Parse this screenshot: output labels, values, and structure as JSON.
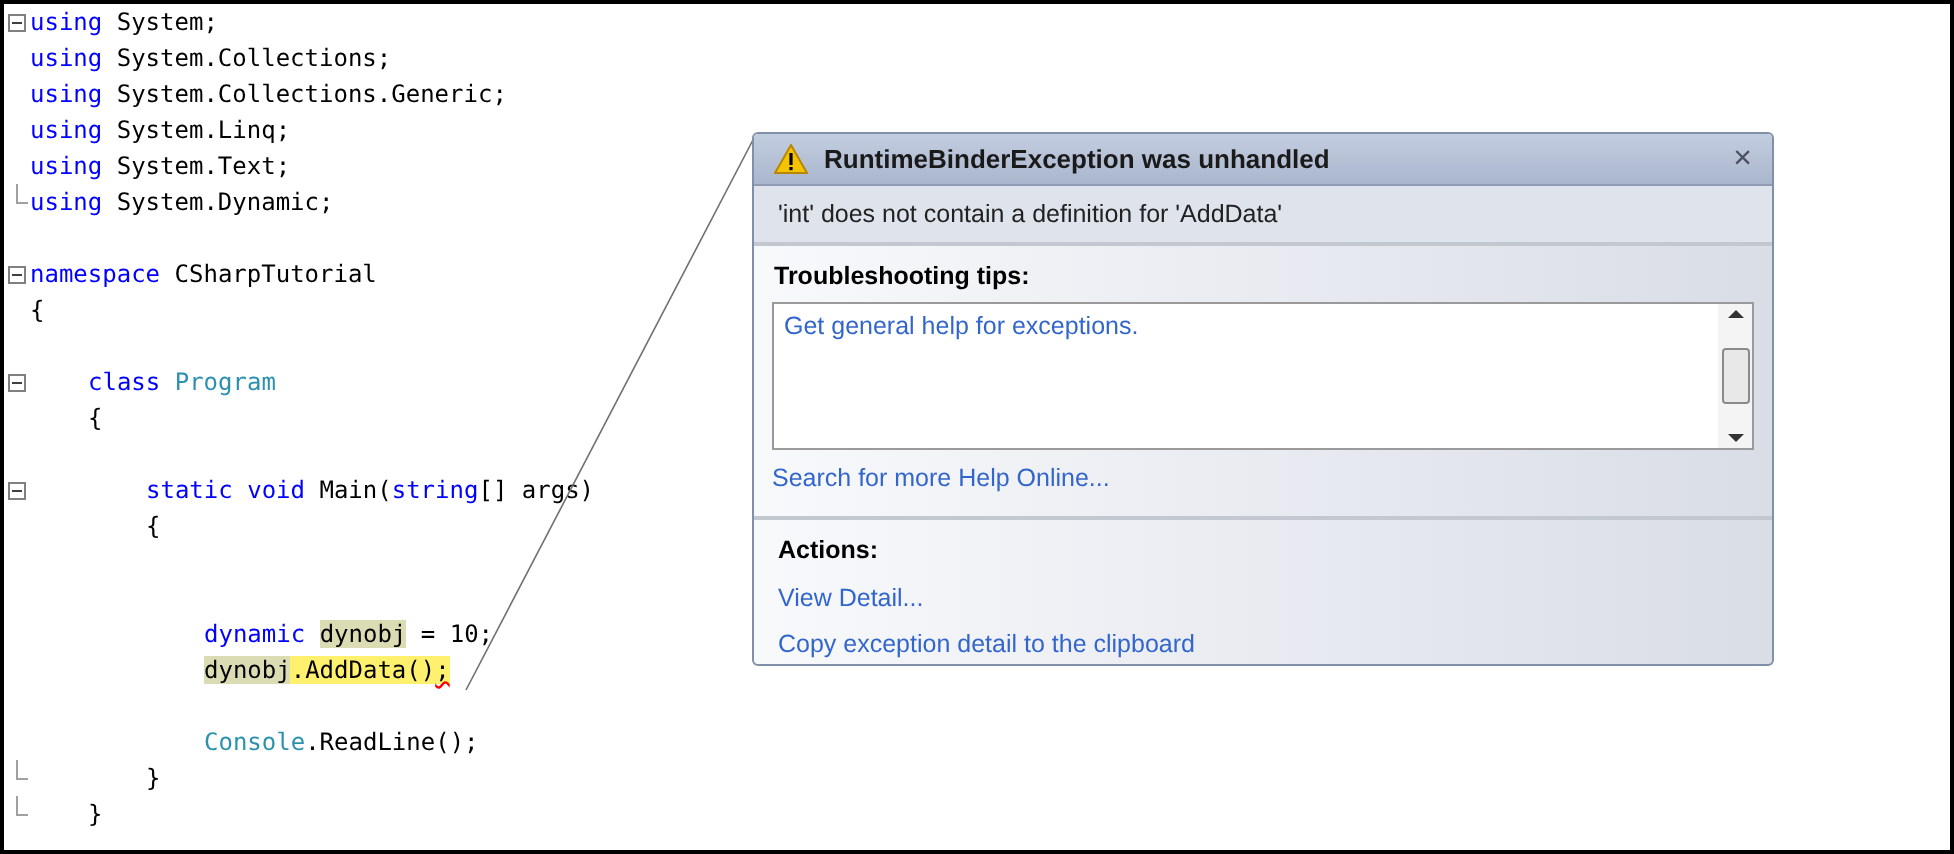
{
  "editor": {
    "lines": [
      {
        "kind": "code",
        "fold_start": true,
        "tokens": [
          {
            "kind": "keyword",
            "text": "using"
          },
          {
            "kind": "plain",
            "text": " System;"
          }
        ]
      },
      {
        "kind": "code",
        "tokens": [
          {
            "kind": "keyword",
            "text": "using"
          },
          {
            "kind": "plain",
            "text": " System.Collections;"
          }
        ]
      },
      {
        "kind": "code",
        "tokens": [
          {
            "kind": "keyword",
            "text": "using"
          },
          {
            "kind": "plain",
            "text": " System.Collections.Generic;"
          }
        ]
      },
      {
        "kind": "code",
        "tokens": [
          {
            "kind": "keyword",
            "text": "using"
          },
          {
            "kind": "plain",
            "text": " System.Linq;"
          }
        ]
      },
      {
        "kind": "code",
        "tokens": [
          {
            "kind": "keyword",
            "text": "using"
          },
          {
            "kind": "plain",
            "text": " System.Text;"
          }
        ]
      },
      {
        "kind": "code",
        "fold_end": true,
        "tokens": [
          {
            "kind": "keyword",
            "text": "using"
          },
          {
            "kind": "plain",
            "text": " System.Dynamic;"
          }
        ]
      },
      {
        "kind": "blank"
      },
      {
        "kind": "code",
        "fold_start": true,
        "tokens": [
          {
            "kind": "keyword",
            "text": "namespace"
          },
          {
            "kind": "plain",
            "text": " CSharpTutorial"
          }
        ]
      },
      {
        "kind": "code",
        "tokens": [
          {
            "kind": "plain",
            "text": "{"
          }
        ],
        "children": [
          {
            "kind": "blank"
          },
          {
            "kind": "code",
            "fold_start": true,
            "tokens": [
              {
                "kind": "keyword",
                "text": "class"
              },
              {
                "kind": "type",
                "text": " Program"
              }
            ]
          },
          {
            "kind": "code",
            "tokens": [
              {
                "kind": "plain",
                "text": "{"
              }
            ],
            "children": [
              {
                "kind": "blank"
              },
              {
                "kind": "code",
                "fold_start": true,
                "tokens": [
                  {
                    "kind": "keyword",
                    "text": "static"
                  },
                  {
                    "kind": "keyword",
                    "text": " void"
                  },
                  {
                    "kind": "plain",
                    "text": " Main("
                  },
                  {
                    "kind": "keyword",
                    "text": "string"
                  },
                  {
                    "kind": "plain",
                    "text": "[] args)"
                  }
                ]
              },
              {
                "kind": "code",
                "tokens": [
                  {
                    "kind": "plain",
                    "text": "{"
                  }
                ],
                "children": [
                  {
                    "kind": "blank"
                  },
                  {
                    "kind": "blank"
                  },
                  {
                    "kind": "code",
                    "tokens": [
                      {
                        "kind": "keyword",
                        "text": "dynamic"
                      },
                      {
                        "kind": "reference",
                        "text": " dynobj"
                      },
                      {
                        "kind": "plain",
                        "text": " = 10;"
                      }
                    ]
                  },
                  {
                    "kind": "code",
                    "tokens": [
                      {
                        "kind": "reference",
                        "text": "dynobj"
                      },
                      {
                        "kind": "current",
                        "text": ".AddData()"
                      },
                      {
                        "kind": "error",
                        "text": ";"
                      }
                    ]
                  },
                  {
                    "kind": "blank"
                  },
                  {
                    "kind": "code",
                    "tokens": [
                      {
                        "kind": "type",
                        "text": "Console"
                      },
                      {
                        "kind": "plain",
                        "text": ".ReadLine();"
                      }
                    ]
                  }
                ]
              },
              {
                "kind": "code",
                "fold_end": true,
                "tokens": [
                  {
                    "kind": "plain",
                    "text": "}"
                  }
                ]
              }
            ]
          },
          {
            "kind": "code",
            "fold_end": true,
            "tokens": [
              {
                "kind": "plain",
                "text": "}"
              }
            ]
          }
        ]
      }
    ]
  },
  "exception_helper": {
    "title": "RuntimeBinderException was unhandled",
    "close": "×",
    "message": "'int' does not contain a definition for 'AddData'",
    "tips_heading": "Troubleshooting tips:",
    "tips": [
      "Get general help for exceptions."
    ],
    "help_link": "Search for more Help Online...",
    "actions_heading": "Actions:",
    "actions": [
      "View Detail...",
      "Copy exception detail to the clipboard"
    ]
  }
}
